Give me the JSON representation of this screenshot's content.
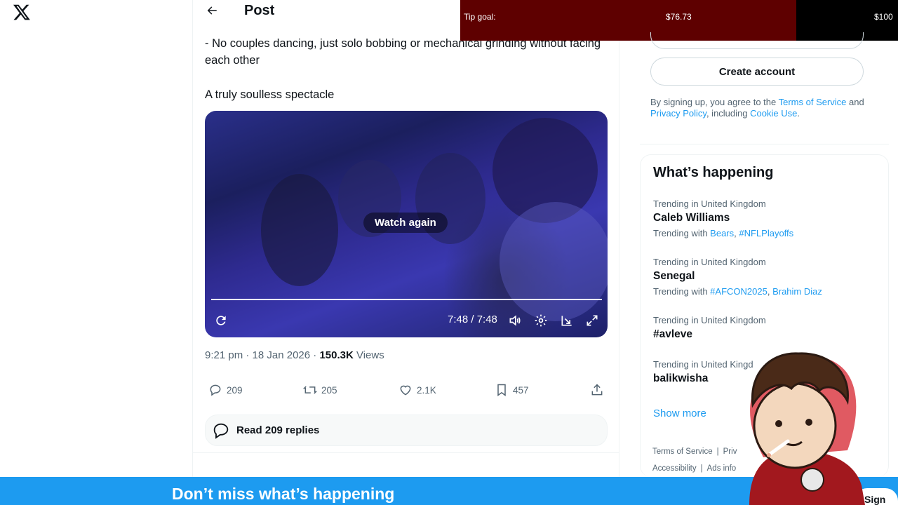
{
  "header": {
    "title": "Post"
  },
  "tweet": {
    "lines": [
      "- No couples dancing, just solo bobbing or mechanical grinding without facing each other",
      "A truly soulless spectacle"
    ],
    "video": {
      "overlay_label": "Watch again",
      "timecode": "7:48 / 7:48",
      "progress": 1.0
    },
    "time": "9:21 pm · 18 Jan 2026 · ",
    "views_count": "150.3K",
    "views_label": "Views",
    "actions": {
      "replies": "209",
      "reposts": "205",
      "likes": "2.1K",
      "bookmarks": "457"
    },
    "read_replies": "Read 209 replies"
  },
  "tip_goal": {
    "label": "Tip goal:",
    "current": "$76.73",
    "goal": "$100",
    "fraction": 0.767
  },
  "sidebar": {
    "create_account": "Create account",
    "terms": {
      "prefix": "By signing up, you agree to the ",
      "tos": "Terms of Service",
      "and": " and ",
      "privacy": "Privacy Policy",
      "including": ", including ",
      "cookie": "Cookie Use",
      "end": "."
    },
    "whats_happening": "What’s happening",
    "trends": [
      {
        "context": "Trending in United Kingdom",
        "name": "Caleb Williams",
        "with_label": "Trending with ",
        "with": [
          "Bears",
          "#NFLPlayoffs"
        ]
      },
      {
        "context": "Trending in United Kingdom",
        "name": "Senegal",
        "with_label": "Trending with ",
        "with": [
          "#AFCON2025",
          "Brahim Diaz"
        ]
      },
      {
        "context": "Trending in United Kingdom",
        "name": "#avleve"
      },
      {
        "context": "Trending in United Kingd",
        "name": "balikwisha"
      }
    ],
    "show_more": "Show more",
    "footer": {
      "terms": "Terms of Service",
      "privacy": "Priv",
      "accessibility": "Accessibility",
      "ads": "Ads info"
    }
  },
  "banner": {
    "text": "Don’t miss what’s happening",
    "signup": "Sign up"
  },
  "colors": {
    "accent": "#1d9bf0",
    "tip_fill": "#5e0000"
  }
}
